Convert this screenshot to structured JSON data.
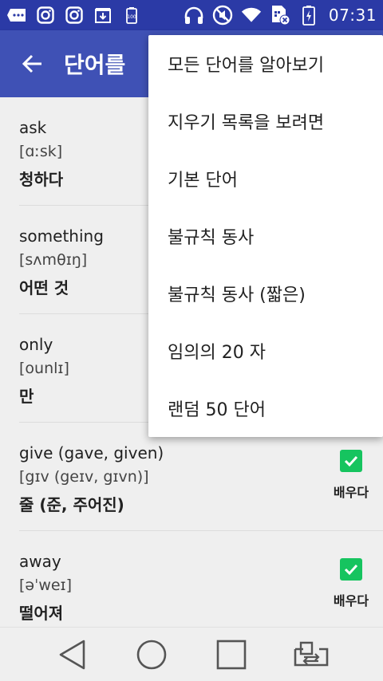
{
  "status_bar": {
    "time": "07:31",
    "left_icons": [
      "message-icon",
      "instagram-icon",
      "instagram-icon",
      "download-box-icon",
      "battery-100-icon"
    ],
    "right_icons": [
      "headphones-icon",
      "mute-icon",
      "wifi-icon",
      "sim-off-icon",
      "battery-charging-icon"
    ]
  },
  "app_bar": {
    "title": "단어를 ",
    "back_icon": "back-arrow-icon"
  },
  "words": [
    {
      "word": "ask",
      "pron": "[ɑːsk]",
      "meaning": "청하다",
      "learned": false,
      "learn_label": ""
    },
    {
      "word": "something",
      "pron": "[sʌmθɪŋ]",
      "meaning": "어떤 것",
      "learned": false,
      "learn_label": ""
    },
    {
      "word": "only",
      "pron": "[ounlɪ]",
      "meaning": "만",
      "learned": false,
      "learn_label": ""
    },
    {
      "word": "give (gave, given)",
      "pron": "[gɪv (geɪv, gɪvn)]",
      "meaning": "줄 (준, 주어진)",
      "learned": true,
      "learn_label": "배우다"
    },
    {
      "word": "away",
      "pron": "[əˈweɪ]",
      "meaning": "떨어져",
      "learned": true,
      "learn_label": "배우다"
    }
  ],
  "menu": {
    "items": [
      "모든 단어를 알아보기",
      "지우기 목록을 보려면",
      "기본 단어",
      "불규칙 동사",
      "불규칙 동사 (짧은)",
      "임의의 20 자",
      "랜덤 50 단어"
    ]
  },
  "nav": {
    "icons": [
      "back-triangle-icon",
      "home-circle-icon",
      "recents-square-icon",
      "screen-switch-icon"
    ]
  },
  "colors": {
    "status_bar": "#2b3aa6",
    "app_bar": "#3f51b5",
    "checkbox": "#16c45f",
    "background": "#efefef"
  }
}
